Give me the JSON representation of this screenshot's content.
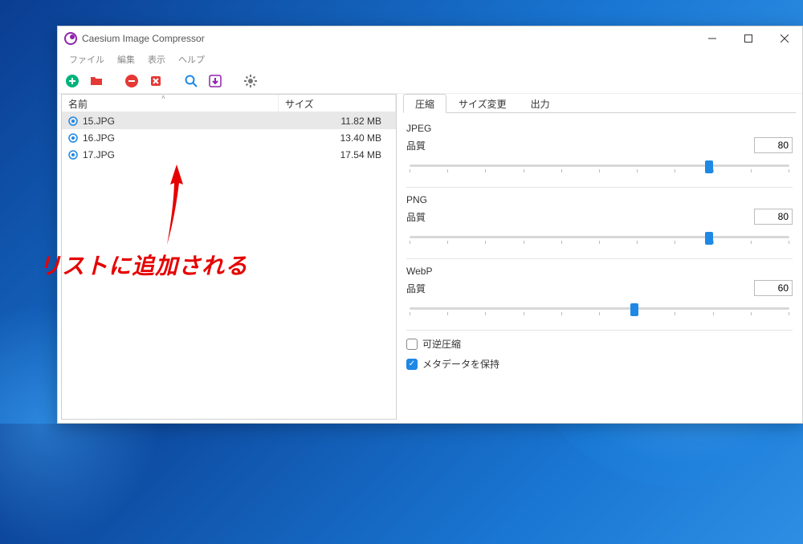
{
  "title": "Caesium Image Compressor",
  "menu": {
    "file": "ファイル",
    "edit": "編集",
    "view": "表示",
    "help": "ヘルプ"
  },
  "columns": {
    "name": "名前",
    "size": "サイズ"
  },
  "files": [
    {
      "name": "15.JPG",
      "size": "11.82 MB",
      "selected": true
    },
    {
      "name": "16.JPG",
      "size": "13.40 MB",
      "selected": false
    },
    {
      "name": "17.JPG",
      "size": "17.54 MB",
      "selected": false
    }
  ],
  "tabs": {
    "compress": "圧縮",
    "resize": "サイズ変更",
    "output": "出力"
  },
  "sections": {
    "jpeg": {
      "label": "JPEG",
      "quality_label": "品質",
      "value": "80",
      "percent": 80
    },
    "png": {
      "label": "PNG",
      "quality_label": "品質",
      "value": "80",
      "percent": 80
    },
    "webp": {
      "label": "WebP",
      "quality_label": "品質",
      "value": "60",
      "percent": 60
    }
  },
  "checkboxes": {
    "lossless": {
      "label": "可逆圧縮",
      "checked": false
    },
    "metadata": {
      "label": "メタデータを保持",
      "checked": true
    }
  },
  "annotation": "リストに追加される"
}
